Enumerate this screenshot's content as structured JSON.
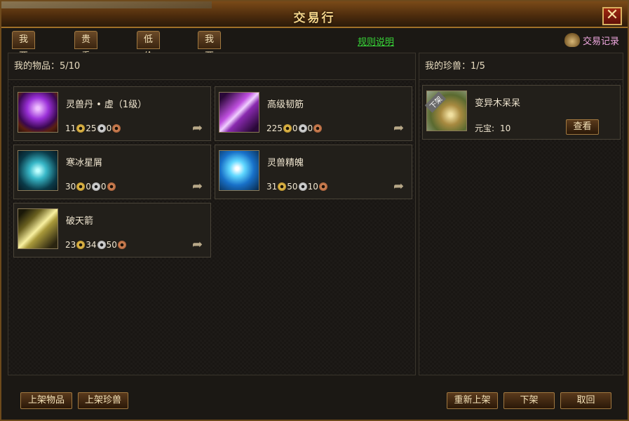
{
  "window": {
    "title": "交易行",
    "close_label": "✕"
  },
  "tabs": [
    "我要购买",
    "贵重公示",
    "低价公示",
    "我要出售"
  ],
  "rules_link": "规则说明",
  "record_button": "交易记录",
  "items_panel": {
    "header": "我的物品：5/10",
    "items": [
      {
        "name": "灵兽丹 • 虚（1级）",
        "gold": "11",
        "silver": "25",
        "copper": "0",
        "icon": "purple-orb-icon"
      },
      {
        "name": "高级韧筋",
        "gold": "225",
        "silver": "0",
        "copper": "0",
        "icon": "sinew-icon"
      },
      {
        "name": "寒冰星屑",
        "gold": "30",
        "silver": "0",
        "copper": "0",
        "icon": "ice-dust-icon"
      },
      {
        "name": "灵兽精魄",
        "gold": "31",
        "silver": "50",
        "copper": "10",
        "icon": "beast-soul-icon"
      },
      {
        "name": "破天箭",
        "gold": "23",
        "silver": "34",
        "copper": "50",
        "icon": "arrow-item-icon"
      }
    ]
  },
  "pets_panel": {
    "header": "我的珍兽：1/5",
    "pet": {
      "name": "变异木呆呆",
      "price_label": "元宝:",
      "price": "10",
      "view_button": "查看",
      "tag": "下架"
    }
  },
  "footer": {
    "list_item_button": "上架物品",
    "list_pet_button": "上架珍兽",
    "relist_button": "重新上架",
    "delist_button": "下架",
    "cancel_button": "取回"
  }
}
